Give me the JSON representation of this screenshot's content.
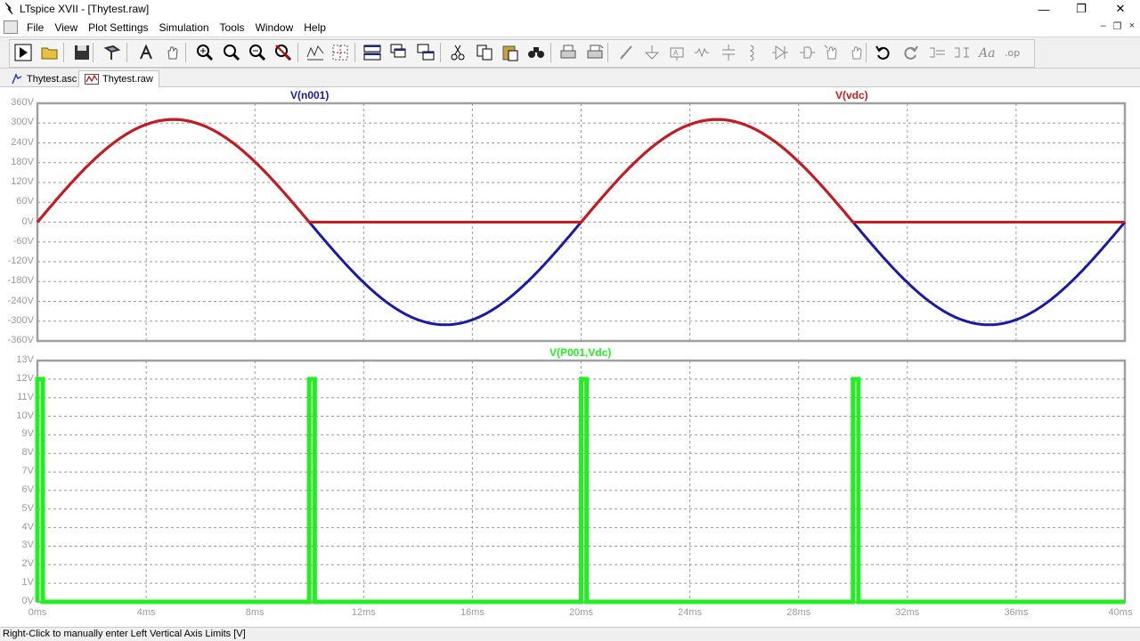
{
  "window": {
    "title": "LTspice XVII - [Thytest.raw]",
    "minimize_glyph": "—",
    "restore_glyph": "❐",
    "close_glyph": "✕"
  },
  "menu": {
    "items": [
      "File",
      "View",
      "Plot Settings",
      "Simulation",
      "Tools",
      "Window",
      "Help"
    ],
    "mdi_minimize": "–",
    "mdi_restore": "❐",
    "mdi_close": "×"
  },
  "toolbar": {
    "icons": [
      "run-icon",
      "open-icon",
      "save-icon",
      "control-panel-icon",
      "halt-icon",
      "pan-hand-icon",
      "zoom-in-icon",
      "zoom-full-icon",
      "zoom-out-icon",
      "zoom-cancel-icon",
      "autorange-icon",
      "grid-icon",
      "tile-horizontal-icon",
      "cascade-icon",
      "tile-vertical-icon",
      "cut-icon",
      "copy-icon",
      "paste-icon",
      "find-icon",
      "print-icon",
      "print-setup-icon",
      "wire-icon",
      "ground-icon",
      "label-icon",
      "resistor-icon",
      "capacitor-icon",
      "inductor-icon",
      "diode-icon",
      "component-icon",
      "move-icon",
      "drag-icon",
      "undo-icon",
      "redo-icon",
      "rotate-icon",
      "mirror-icon",
      "text-icon",
      "spice-directive-icon"
    ]
  },
  "tabs": [
    {
      "label": "Thytest.asc",
      "icon": "schematic-icon",
      "active": false
    },
    {
      "label": "Thytest.raw",
      "icon": "waveform-icon",
      "active": true
    }
  ],
  "status": {
    "text": "Right-Click to manually enter Left Vertical Axis Limits [V]"
  },
  "colors": {
    "vn001": "#1a1aa8",
    "vvdc": "#cc1a1a",
    "vp001": "#22ee22",
    "frame": "#a0a0a0",
    "grid": "#9a9a9a"
  },
  "chart_data": [
    {
      "type": "line",
      "title": "",
      "series": [
        {
          "name": "V(n001)",
          "function": "311*sin(2*pi*50*t)",
          "x": [
            0,
            2.5,
            5,
            7.5,
            10,
            12.5,
            15,
            17.5,
            20,
            22.5,
            25,
            27.5,
            30,
            32.5,
            35,
            37.5,
            40
          ],
          "y": [
            0,
            220,
            311,
            220,
            0,
            -220,
            -311,
            -220,
            0,
            220,
            311,
            220,
            0,
            -220,
            -311,
            -220,
            0
          ]
        },
        {
          "name": "V(vdc)",
          "function": "max(0, 311*sin(2*pi*50*t))",
          "x": [
            0,
            2.5,
            5,
            7.5,
            10,
            12.5,
            15,
            17.5,
            20,
            22.5,
            25,
            27.5,
            30,
            32.5,
            35,
            37.5,
            40
          ],
          "y": [
            0,
            220,
            311,
            220,
            0,
            0,
            0,
            0,
            0,
            220,
            311,
            220,
            0,
            0,
            0,
            0,
            0
          ]
        }
      ],
      "xlim": [
        0,
        40
      ],
      "ylim": [
        -360,
        360
      ],
      "yticks": [
        "360V",
        "300V",
        "240V",
        "180V",
        "120V",
        "60V",
        "0V",
        "-60V",
        "-120V",
        "-180V",
        "-240V",
        "-300V",
        "-360V"
      ],
      "ytick_values": [
        360,
        300,
        240,
        180,
        120,
        60,
        0,
        -60,
        -120,
        -180,
        -240,
        -300,
        -360
      ],
      "grid": true
    },
    {
      "type": "line",
      "title": "",
      "series": [
        {
          "name": "V(P001,Vdc)",
          "pulse_times": [
            0,
            10,
            20,
            30
          ],
          "pulse_width": 0.2,
          "high": 12,
          "low": 0
        }
      ],
      "xlim": [
        0,
        40
      ],
      "ylim": [
        0,
        13
      ],
      "yticks": [
        "13V",
        "12V",
        "11V",
        "10V",
        "9V",
        "8V",
        "7V",
        "6V",
        "5V",
        "4V",
        "3V",
        "2V",
        "1V",
        "0V"
      ],
      "ytick_values": [
        13,
        12,
        11,
        10,
        9,
        8,
        7,
        6,
        5,
        4,
        3,
        2,
        1,
        0
      ],
      "xticks": [
        "0ms",
        "4ms",
        "8ms",
        "12ms",
        "16ms",
        "20ms",
        "24ms",
        "28ms",
        "32ms",
        "36ms",
        "40ms"
      ],
      "xtick_values": [
        0,
        4,
        8,
        12,
        16,
        20,
        24,
        28,
        32,
        36,
        40
      ],
      "grid": true
    }
  ]
}
